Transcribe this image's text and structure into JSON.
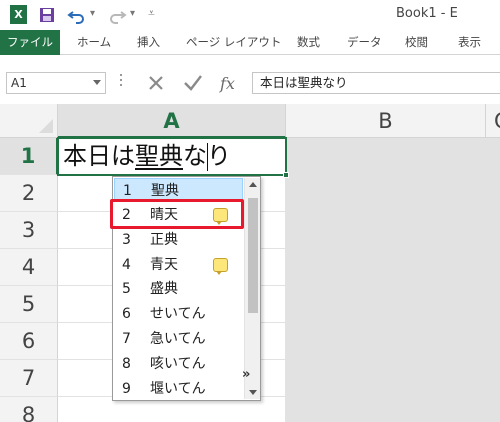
{
  "title_bar": {
    "app_logo": "X",
    "document_title": "Book1 - E",
    "icons": [
      "excel-logo-icon",
      "save-icon",
      "undo-icon",
      "redo-icon",
      "customize-qat-icon"
    ]
  },
  "ribbon": {
    "tabs": [
      "ファイル",
      "ホーム",
      "挿入",
      "ページ レイアウト",
      "数式",
      "データ",
      "校閲",
      "表示"
    ],
    "file_tab_color": "#217346"
  },
  "formula_bar": {
    "name_box": "A1",
    "formula": "本日は聖典なり",
    "icons": [
      "cancel-icon",
      "enter-icon",
      "insert-function-icon"
    ]
  },
  "grid": {
    "columns": [
      "A",
      "B",
      "C"
    ],
    "rows": [
      "1",
      "2",
      "3",
      "4",
      "5",
      "6",
      "7",
      "8",
      "9"
    ],
    "active_cell_text": {
      "before": "本日は",
      "converting": "聖典",
      "after": "なり"
    },
    "accent_color": "#217346"
  },
  "ime_candidates": {
    "items": [
      {
        "num": "1",
        "text": "聖典",
        "selected": true,
        "memo": false
      },
      {
        "num": "2",
        "text": "晴天",
        "selected": false,
        "memo": true
      },
      {
        "num": "3",
        "text": "正典",
        "selected": false,
        "memo": false
      },
      {
        "num": "4",
        "text": "青天",
        "selected": false,
        "memo": true
      },
      {
        "num": "5",
        "text": "盛典",
        "selected": false,
        "memo": false
      },
      {
        "num": "6",
        "text": "せいてん",
        "selected": false,
        "memo": false
      },
      {
        "num": "7",
        "text": "急いてん",
        "selected": false,
        "memo": false
      },
      {
        "num": "8",
        "text": "咳いてん",
        "selected": false,
        "memo": false
      },
      {
        "num": "9",
        "text": "堰いてん",
        "selected": false,
        "memo": false
      }
    ],
    "more_glyph": "»",
    "highlight_color": "#e8192c"
  }
}
